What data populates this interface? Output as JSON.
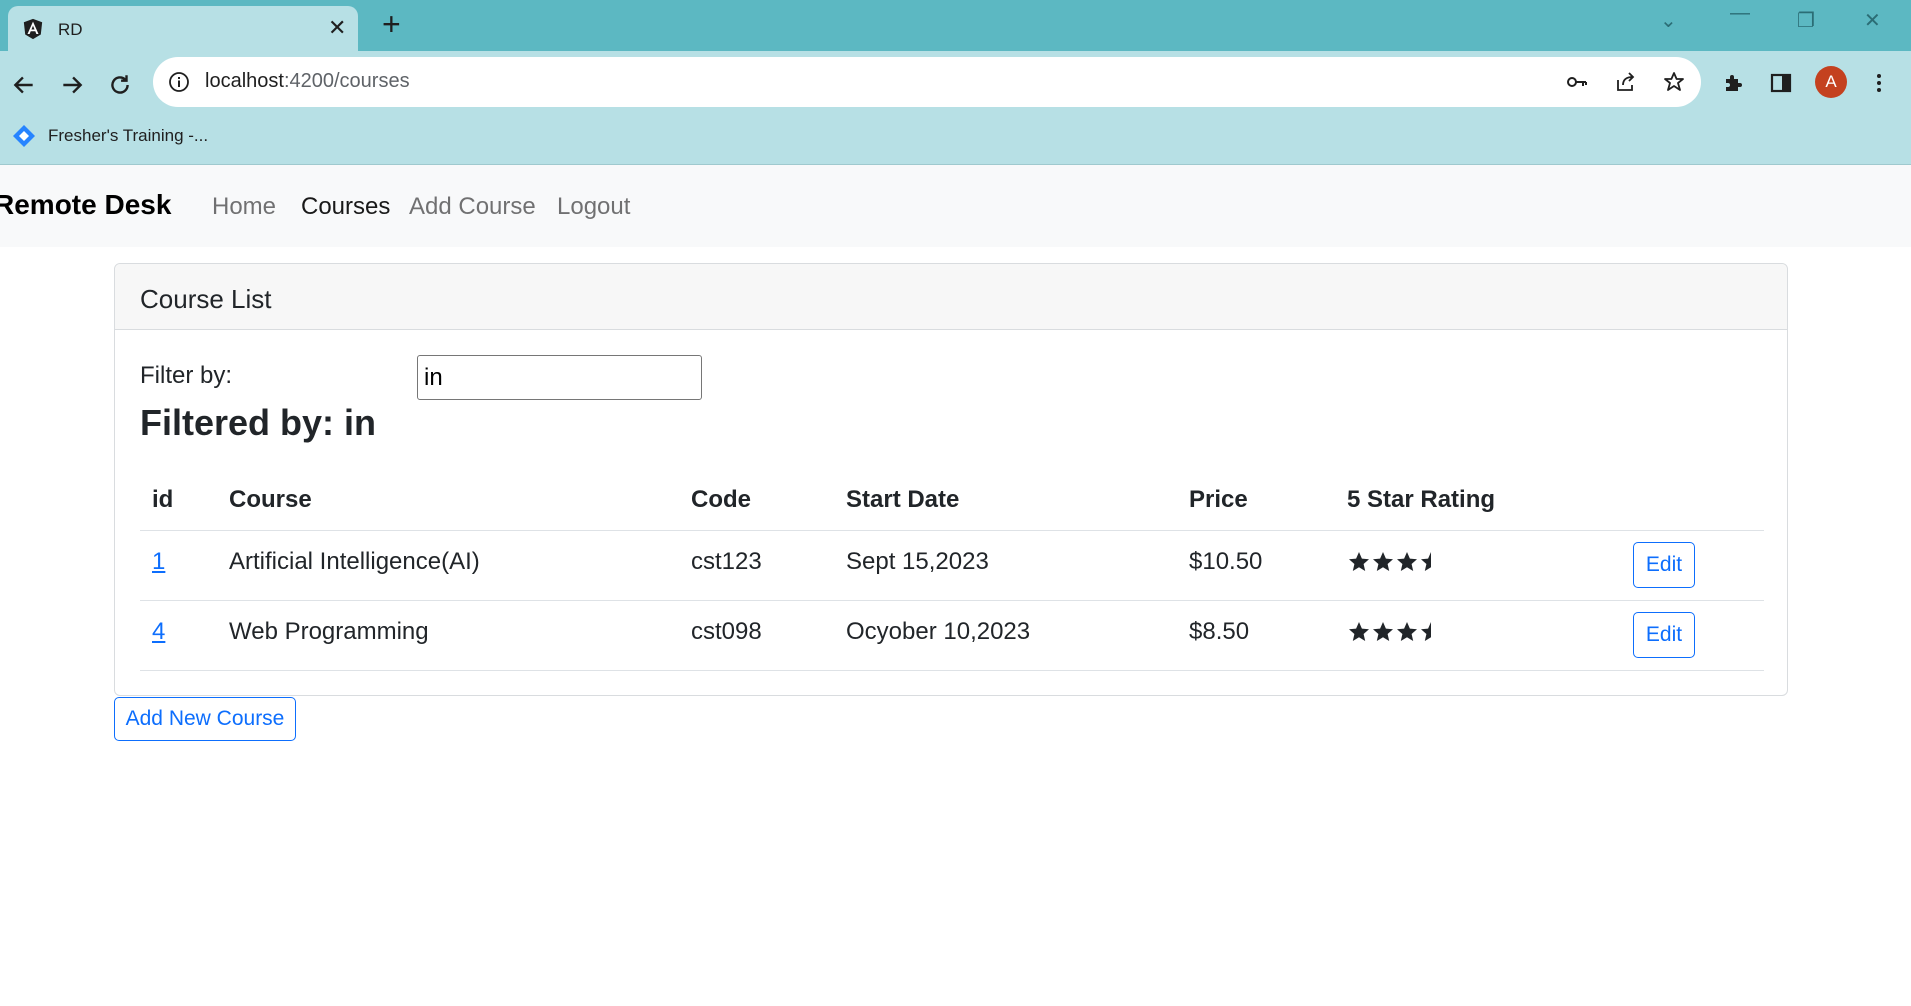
{
  "browser": {
    "tab_title": "RD",
    "url_host": "localhost",
    "url_path": ":4200/courses",
    "bookmark_label": "Fresher's Training -...",
    "avatar_letter": "A",
    "tab_bg": "#b7e0e5",
    "frame_color": "#5cb8c2"
  },
  "navbar": {
    "brand": "Remote Desk",
    "links": [
      {
        "label": "Home",
        "active": false
      },
      {
        "label": "Courses",
        "active": true
      },
      {
        "label": "Add Course",
        "active": false
      },
      {
        "label": "Logout",
        "active": false
      }
    ]
  },
  "card": {
    "title": "Course List",
    "filter_label": "Filter by:",
    "filter_value": "in",
    "filtered_heading": "Filtered by: in"
  },
  "table": {
    "headers": [
      "id",
      "Course",
      "Code",
      "Start Date",
      "Price",
      "5 Star Rating"
    ],
    "rows": [
      {
        "id": "1",
        "course": "Artificial Intelligence(AI)",
        "code": "cst123",
        "start_date": "Sept 15,2023",
        "price": "$10.50",
        "rating": 3.5,
        "edit_label": "Edit"
      },
      {
        "id": "4",
        "course": "Web Programming",
        "code": "cst098",
        "start_date": "Ocyober 10,2023",
        "price": "$8.50",
        "rating": 3.5,
        "edit_label": "Edit"
      }
    ]
  },
  "add_button_label": "Add New Course",
  "colors": {
    "primary": "#0d6efd",
    "navbar_bg": "#f8f9fa",
    "star": "#212529"
  },
  "icons": {
    "tab_favicon": "angular-icon",
    "tab_close": "close-icon",
    "new_tab": "plus-icon",
    "back": "arrow-left-icon",
    "forward": "arrow-right-icon",
    "reload": "reload-icon",
    "site_info": "info-icon",
    "key": "key-icon",
    "share": "share-icon",
    "bookmark_star": "star-outline-icon",
    "extensions": "puzzle-icon",
    "side_panel": "side-panel-icon",
    "menu": "kebab-menu-icon",
    "bookmark_favicon": "diamond-icon"
  }
}
